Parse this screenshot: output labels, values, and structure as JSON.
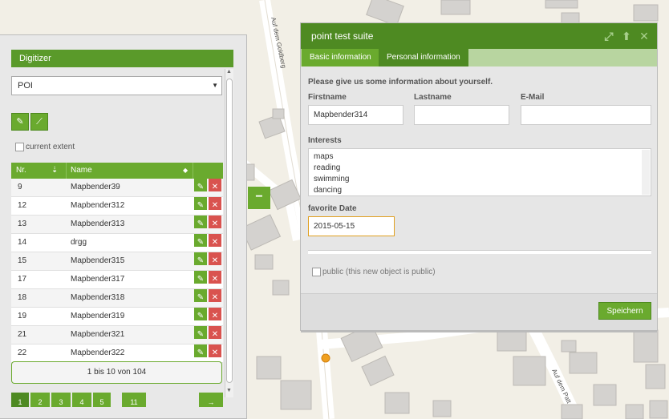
{
  "map": {
    "street_labels": [
      "Auf dem Goldberg",
      "Auf dem Patt"
    ],
    "marker_color": "#f0a020"
  },
  "digitizer": {
    "title": "Digitizer",
    "layer_select": "POI",
    "tools": [
      "edit-point-icon",
      "draw-line-icon"
    ],
    "current_extent_label": "current extent",
    "columns": {
      "nr": "Nr.",
      "name": "Name"
    },
    "rows": [
      {
        "nr": "9",
        "name": "Mapbender39"
      },
      {
        "nr": "12",
        "name": "Mapbender312"
      },
      {
        "nr": "13",
        "name": "Mapbender313"
      },
      {
        "nr": "14",
        "name": "drgg"
      },
      {
        "nr": "15",
        "name": "Mapbender315"
      },
      {
        "nr": "17",
        "name": "Mapbender317"
      },
      {
        "nr": "18",
        "name": "Mapbender318"
      },
      {
        "nr": "19",
        "name": "Mapbender319"
      },
      {
        "nr": "21",
        "name": "Mapbender321"
      },
      {
        "nr": "22",
        "name": "Mapbender322"
      }
    ],
    "page_info": "1 bis 10 von 104",
    "pages": [
      "1",
      "2",
      "3",
      "4",
      "5",
      "11",
      "→"
    ],
    "toggle_label": "−",
    "accent_color": "#6aaa2e",
    "delete_color": "#d9534f"
  },
  "popup": {
    "title": "point test suite",
    "tabs": [
      "Basic information",
      "Personal information"
    ],
    "intro": "Please give us some information about yourself.",
    "firstname_label": "Firstname",
    "firstname_value": "Mapbender314",
    "lastname_label": "Lastname",
    "lastname_value": "",
    "email_label": "E-Mail",
    "email_value": "",
    "interests_label": "Interests",
    "interests": [
      "maps",
      "reading",
      "swimming",
      "dancing"
    ],
    "date_label": "favorite Date",
    "date_value": "2015-05-15",
    "public_label": "public (this new object is public)",
    "save_label": "Speichern",
    "title_color": "#4e8a22"
  }
}
